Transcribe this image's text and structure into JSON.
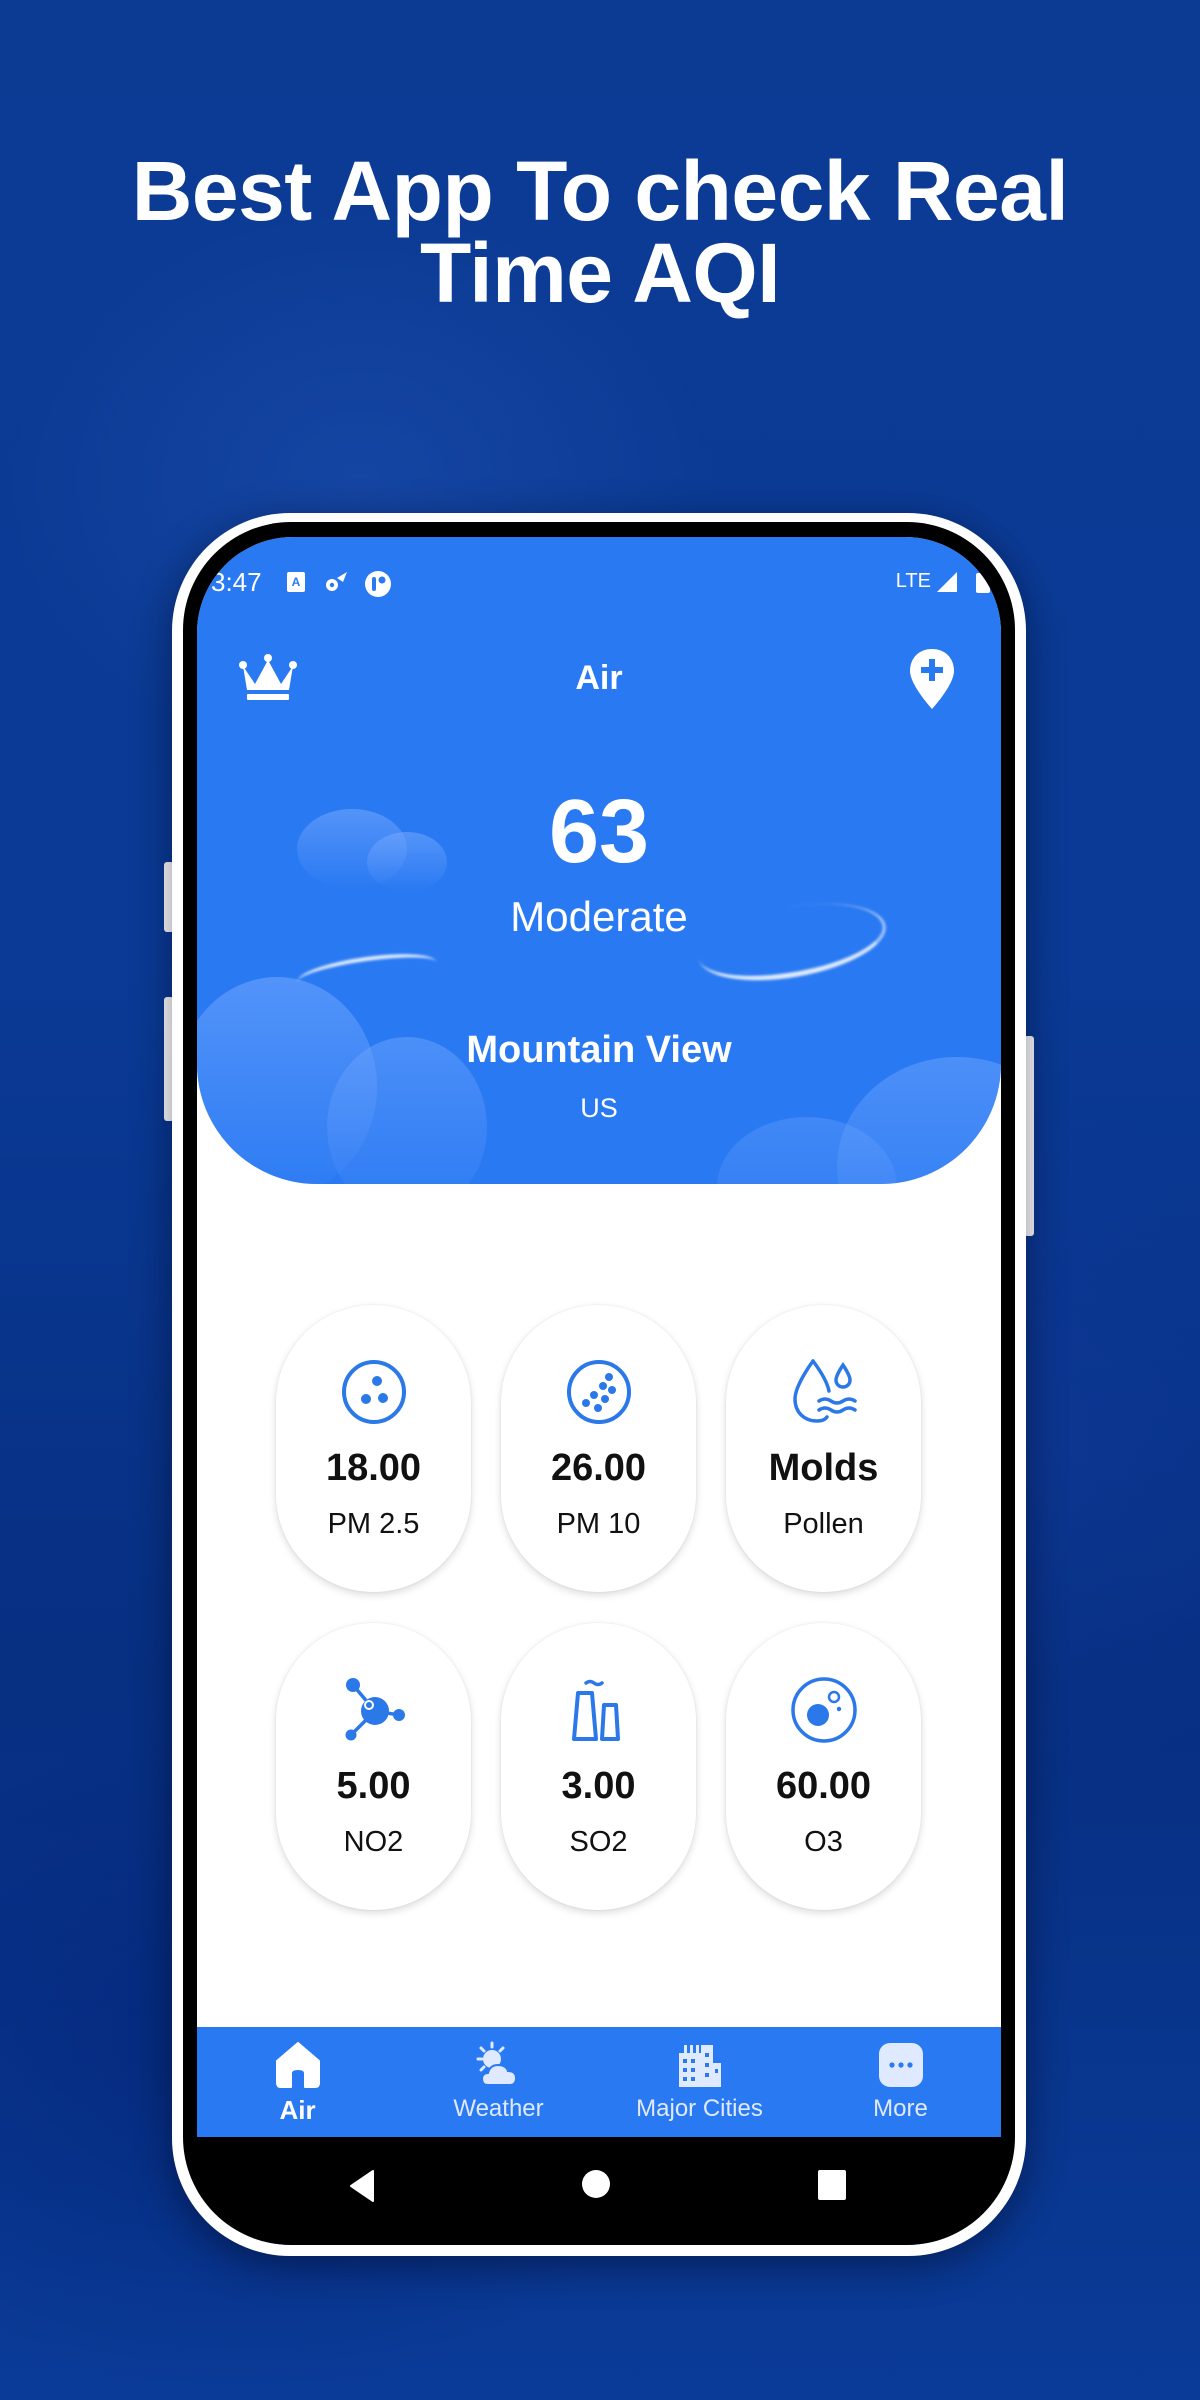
{
  "promo": {
    "headline_line1": "Best App To check Real",
    "headline_line2": "Time AQI"
  },
  "status_bar": {
    "time": "3:47",
    "network": "LTE",
    "icons_left": [
      "keyboard-a-icon",
      "settings-wifi-icon",
      "app-notification-icon"
    ],
    "icons_right": [
      "signal-icon",
      "battery-icon"
    ]
  },
  "app_bar": {
    "title": "Air",
    "left_icon": "crown-icon",
    "right_icon": "add-location-icon"
  },
  "aqi": {
    "value": "63",
    "status": "Moderate",
    "city": "Mountain View",
    "country": "US"
  },
  "pollutants": [
    {
      "value": "18.00",
      "label": "PM 2.5",
      "icon": "pm25-icon"
    },
    {
      "value": "26.00",
      "label": "PM 10",
      "icon": "pm10-icon"
    },
    {
      "value": "Molds",
      "label": "Pollen",
      "icon": "pollen-drops-icon"
    },
    {
      "value": "5.00",
      "label": "NO2",
      "icon": "molecule-icon"
    },
    {
      "value": "3.00",
      "label": "SO2",
      "icon": "factory-icon"
    },
    {
      "value": "60.00",
      "label": "O3",
      "icon": "ozone-icon"
    }
  ],
  "bottom_nav": {
    "items": [
      {
        "label": "Air",
        "icon": "home-icon",
        "active": true
      },
      {
        "label": "Weather",
        "icon": "weather-icon",
        "active": false
      },
      {
        "label": "Major Cities",
        "icon": "city-icon",
        "active": false
      },
      {
        "label": "More",
        "icon": "more-icon",
        "active": false
      }
    ]
  },
  "colors": {
    "primary": "#2979F2",
    "icon_blue": "#2B78E8",
    "background": "#0A3A96"
  }
}
